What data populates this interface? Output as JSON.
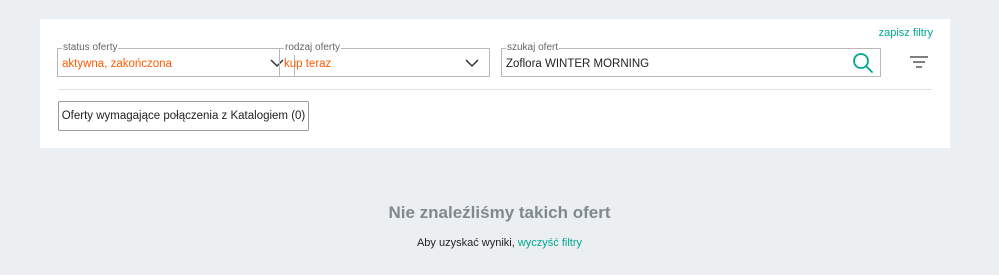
{
  "filters": {
    "save_label": "zapisz filtry",
    "status": {
      "legend": "status oferty",
      "value": "aktywna, zakończona"
    },
    "type": {
      "legend": "rodzaj oferty",
      "value": "kup teraz"
    },
    "search": {
      "legend": "szukaj ofert",
      "value": "Zoflora WINTER MORNING"
    }
  },
  "catalog_button_label": "Oferty wymagające połączenia z Katalogiem (0)",
  "empty_state": {
    "title": "Nie znaleźliśmy takich ofert",
    "hint_prefix": "Aby uzyskać wyniki, ",
    "hint_link": "wyczyść filtry"
  },
  "colors": {
    "accent": "#00a790",
    "value_orange": "#ff5a00",
    "background": "#eceff1"
  },
  "icons": [
    "chevron-down-icon",
    "search-icon",
    "filter-icon"
  ]
}
